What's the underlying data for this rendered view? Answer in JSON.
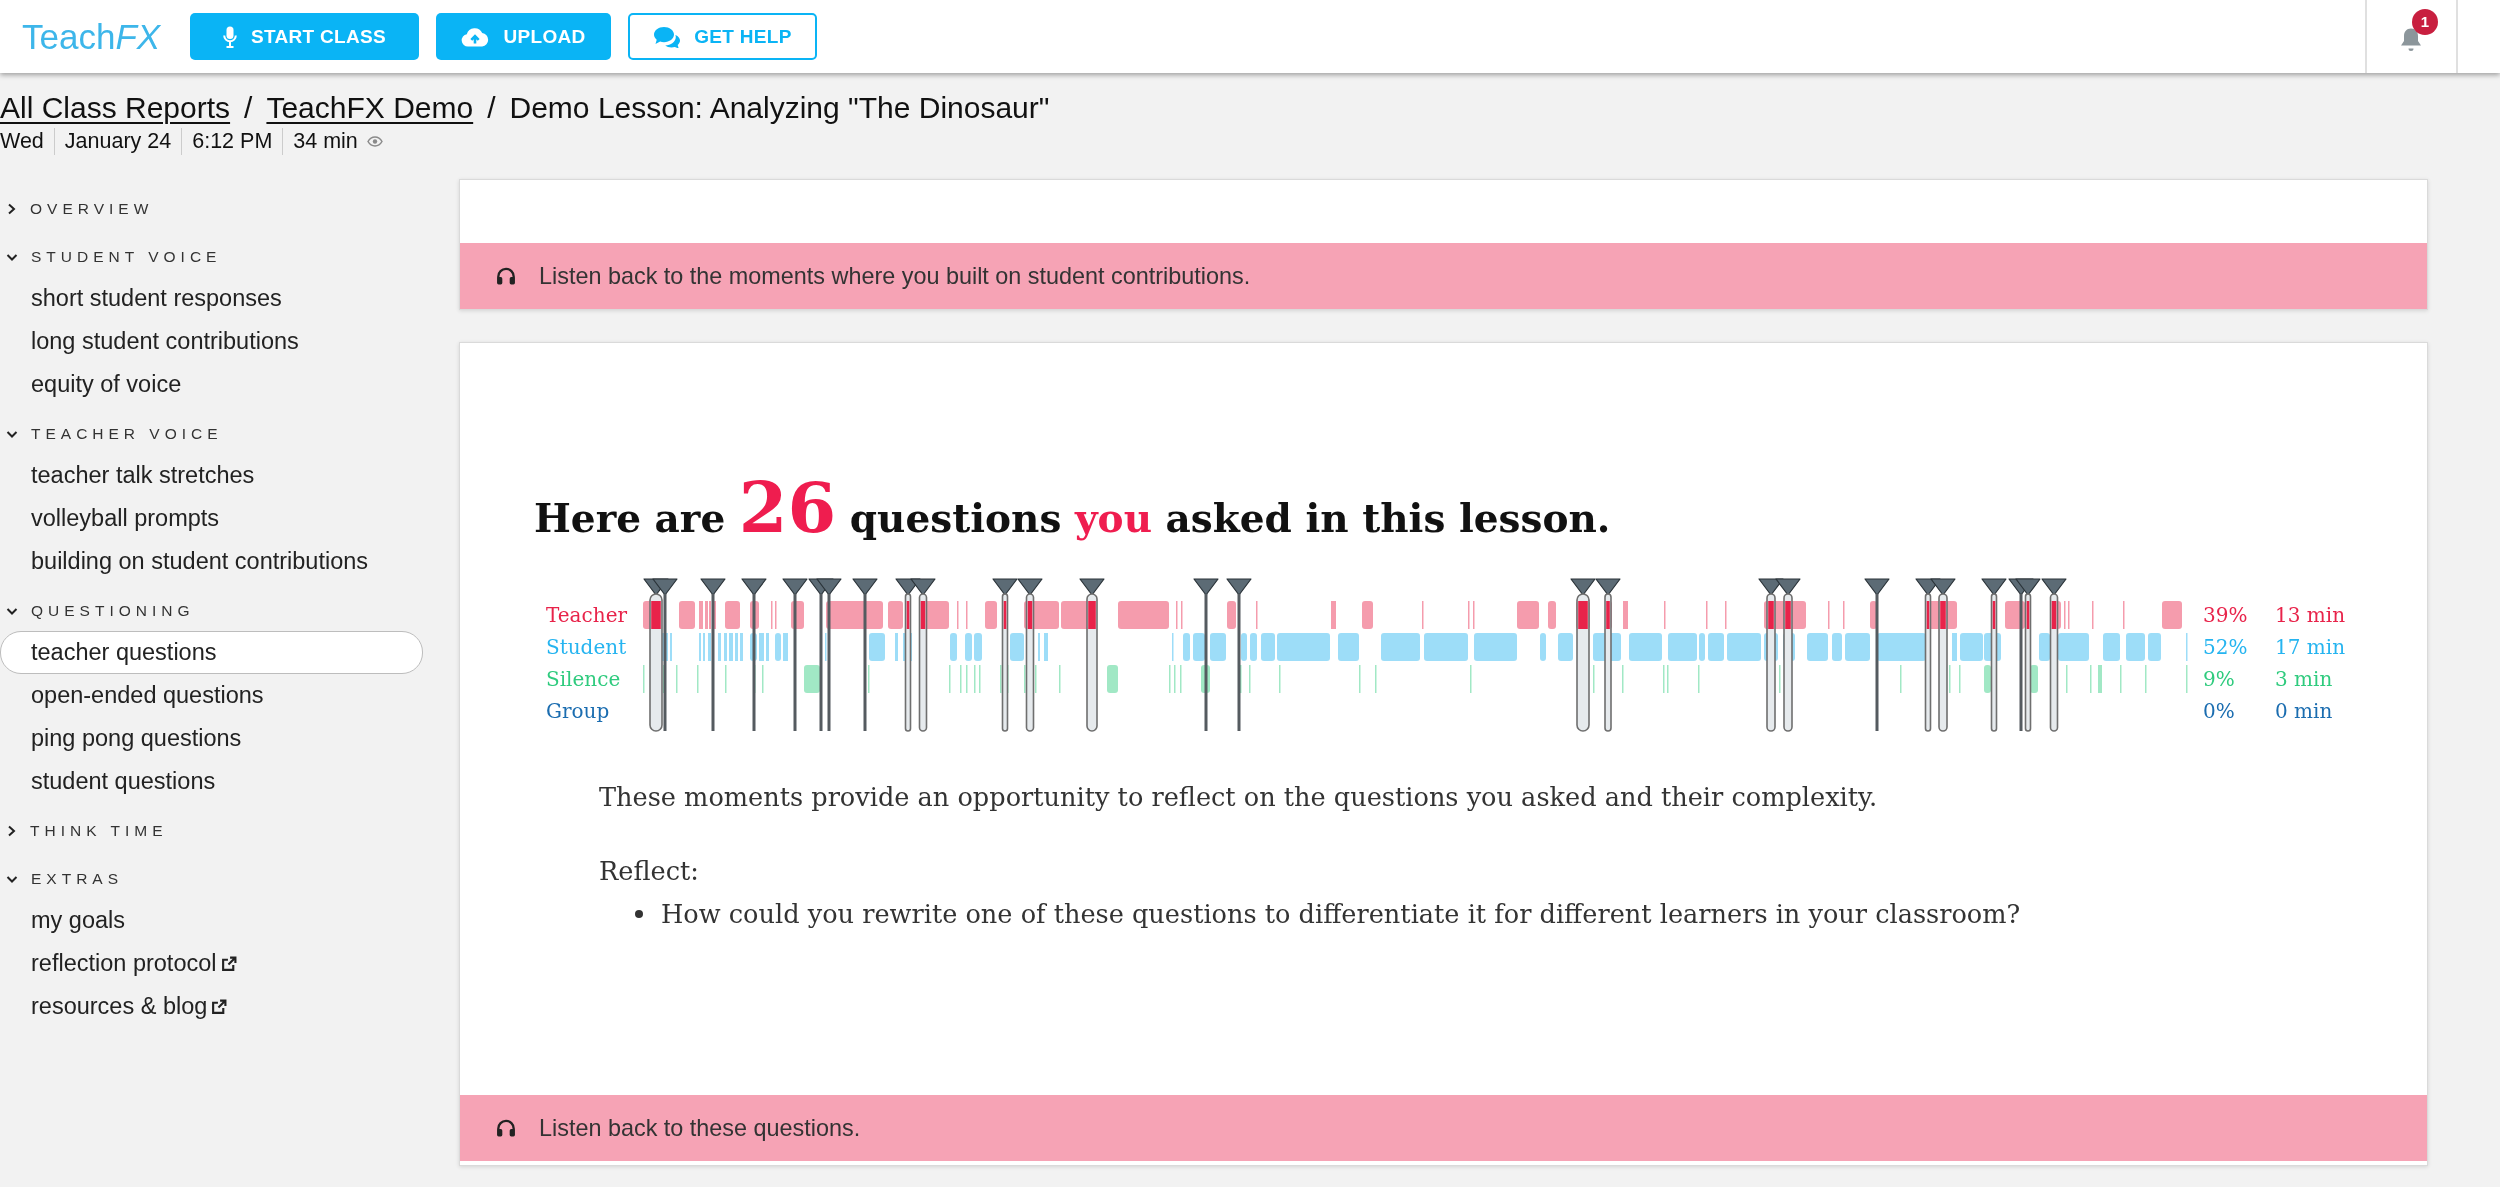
{
  "top_bar": {
    "logo": [
      {
        "text": "Teach",
        "kind": "plain"
      },
      {
        "text": "FX",
        "kind": "italic"
      }
    ],
    "buttons": [
      {
        "label": "START CLASS",
        "kind": "filled"
      },
      {
        "label": "UPLOAD",
        "kind": "filled"
      },
      {
        "label": "GET HELP",
        "kind": "outline"
      }
    ],
    "notification_badge": "1"
  },
  "breadcrumb": [
    {
      "label": "All Class Reports",
      "kind": "link"
    },
    {
      "label": "/",
      "kind": "separator"
    },
    {
      "label": "TeachFX Demo",
      "kind": "link"
    },
    {
      "label": "/",
      "kind": "separator"
    },
    {
      "label": "Demo Lesson: Analyzing \"The Dinosaur\"",
      "kind": "current"
    }
  ],
  "lesson_info": [
    {
      "text": "Wed",
      "kind": "day"
    },
    {
      "text": "January 24",
      "kind": "date"
    },
    {
      "text": "6:12 PM",
      "kind": "time"
    },
    {
      "text": "34 min",
      "kind": "duration"
    }
  ],
  "sidebar": {
    "sections": [
      {
        "title": "OVERVIEW",
        "expanded": false
      },
      {
        "title": "STUDENT VOICE",
        "expanded": true,
        "items": [
          {
            "label": "short student responses",
            "selected": false,
            "external": false
          },
          {
            "label": "long student contributions",
            "selected": false,
            "external": false
          },
          {
            "label": "equity of voice",
            "selected": false,
            "external": false
          }
        ]
      },
      {
        "title": "TEACHER VOICE",
        "expanded": true,
        "items": [
          {
            "label": "teacher talk stretches",
            "selected": false,
            "external": false
          },
          {
            "label": "volleyball prompts",
            "selected": false,
            "external": false
          },
          {
            "label": "building on student contributions",
            "selected": false,
            "external": false
          }
        ]
      },
      {
        "title": "QUESTIONING",
        "expanded": true,
        "items": [
          {
            "label": "teacher questions",
            "selected": true,
            "external": false
          },
          {
            "label": "open-ended questions",
            "selected": false,
            "external": false
          },
          {
            "label": "ping pong questions",
            "selected": false,
            "external": false
          },
          {
            "label": "student questions",
            "selected": false,
            "external": false
          }
        ]
      },
      {
        "title": "THINK TIME",
        "expanded": false
      },
      {
        "title": "EXTRAS",
        "expanded": true,
        "items": [
          {
            "label": "my goals",
            "selected": false,
            "external": false
          },
          {
            "label": "reflection protocol",
            "selected": false,
            "external": true
          },
          {
            "label": "resources & blog",
            "selected": false,
            "external": true
          }
        ]
      }
    ]
  },
  "main": {
    "top_card": {
      "banner": "Listen back to the moments where you built on student contributions."
    },
    "questions_card": {
      "heading": [
        {
          "text": "Here are ",
          "kind": "plain"
        },
        {
          "text": "26",
          "kind": "count"
        },
        {
          "text": " questions ",
          "kind": "plain"
        },
        {
          "text": "you",
          "kind": "highlight"
        },
        {
          "text": " asked in this lesson.",
          "kind": "plain"
        }
      ],
      "timeline": {
        "rows": [
          {
            "label": "Teacher",
            "percent": "39%",
            "duration": "13 min",
            "color": "#e8234a"
          },
          {
            "label": "Student",
            "percent": "52%",
            "duration": "17 min",
            "color": "#25b4f0"
          },
          {
            "label": "Silence",
            "percent": "9%",
            "duration": "3 min",
            "color": "#2fcb7e"
          },
          {
            "label": "Group",
            "percent": "0%",
            "duration": "0 min",
            "color": "#1b6db0"
          }
        ]
      },
      "description": "These moments provide an opportunity to reflect on the questions you asked and their complexity.",
      "reflect": {
        "title": "Reflect:",
        "bullets": [
          "How could you rewrite one of these questions to differentiate it for different learners in your classroom?"
        ]
      },
      "banner": "Listen back to these questions."
    }
  }
}
